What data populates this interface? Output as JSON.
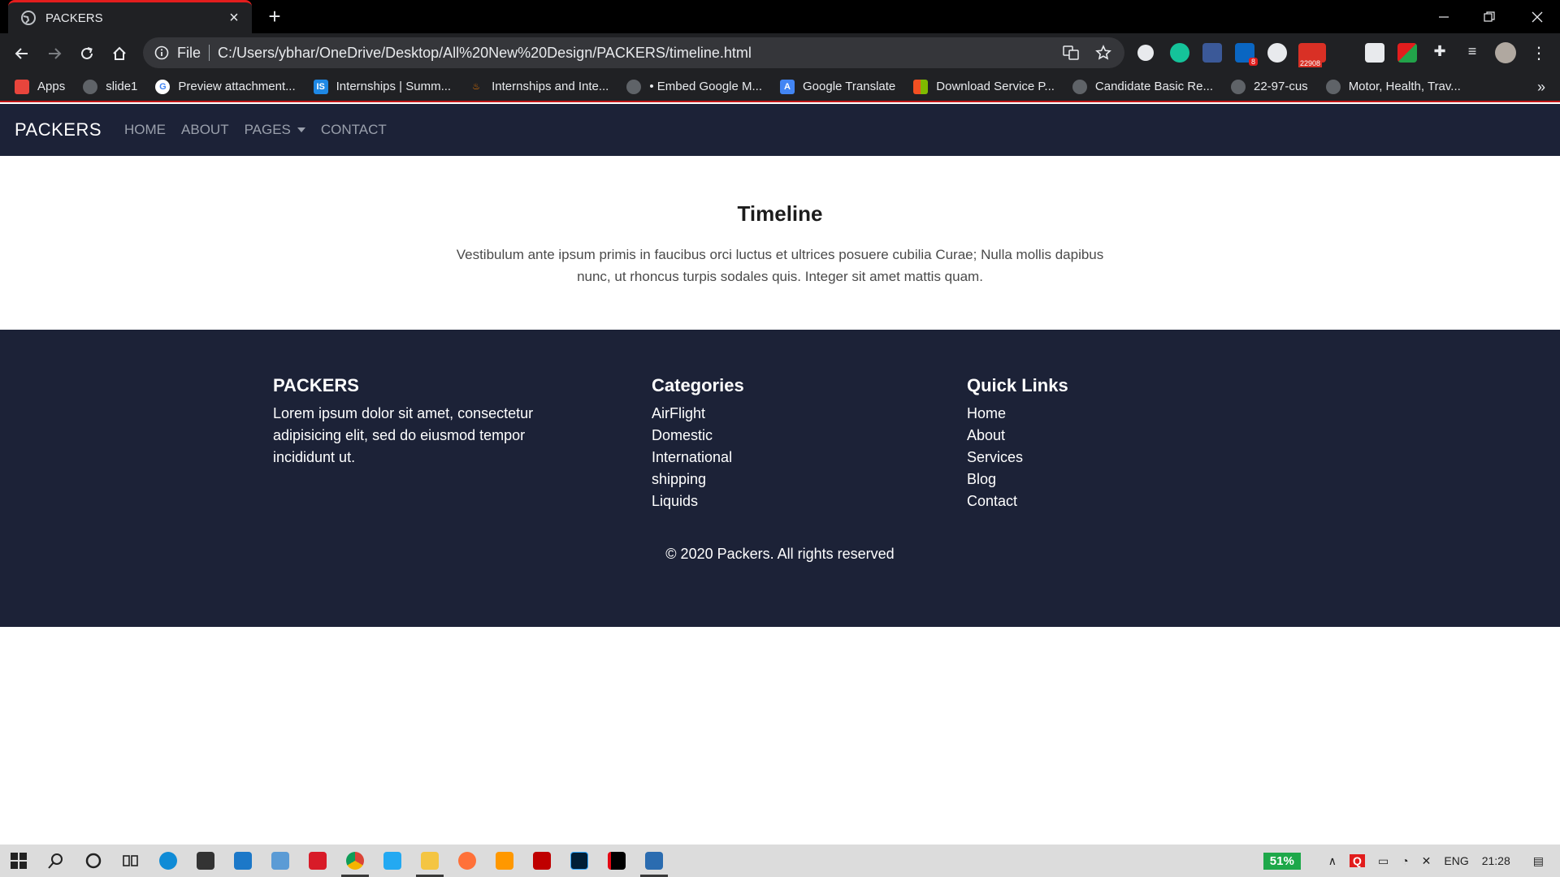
{
  "browser": {
    "tab_title": "PACKERS",
    "new_tab": "+",
    "tab_close": "×",
    "url_scheme": "File",
    "url": "C:/Users/ybhar/OneDrive/Desktop/All%20New%20Design/PACKERS/timeline.html",
    "bookmarks": [
      {
        "label": "Apps",
        "icon": "apps-grid-icon",
        "color": "#e8453c"
      },
      {
        "label": "slide1",
        "icon": "globe-icon",
        "color": "#5f6368"
      },
      {
        "label": "Preview attachment...",
        "icon": "google-icon",
        "color": "#ffffff"
      },
      {
        "label": "Internships | Summ...",
        "icon": "is-icon",
        "color": "#1e88e5"
      },
      {
        "label": "Internships and Inte...",
        "icon": "flame-icon",
        "color": "#202124"
      },
      {
        "label": "• Embed Google M...",
        "icon": "globe-icon",
        "color": "#5f6368"
      },
      {
        "label": "Google Translate",
        "icon": "translate-icon",
        "color": "#4285f4"
      },
      {
        "label": "Download Service P...",
        "icon": "microsoft-icon",
        "color": "#f25022"
      },
      {
        "label": "Candidate Basic Re...",
        "icon": "globe-icon",
        "color": "#5f6368"
      },
      {
        "label": "22-97-cus",
        "icon": "globe-icon",
        "color": "#5f6368"
      },
      {
        "label": "Motor, Health, Trav...",
        "icon": "globe-icon",
        "color": "#5f6368"
      }
    ],
    "more": "»",
    "badges": {
      "linkedin": "8",
      "mail": "22908"
    }
  },
  "site": {
    "brand": "PACKERS",
    "nav": [
      "HOME",
      "ABOUT",
      "PAGES",
      "CONTACT"
    ],
    "hero_title": "Timeline",
    "hero_text": "Vestibulum ante ipsum primis in faucibus orci luctus et ultrices posuere cubilia Curae; Nulla mollis dapibus nunc, ut rhoncus turpis sodales quis. Integer sit amet mattis quam.",
    "footer": {
      "about_title": "PACKERS",
      "about_text": "Lorem ipsum dolor sit amet, consectetur adipisicing elit, sed do eiusmod tempor incididunt ut.",
      "categories_title": "Categories",
      "categories": [
        "AirFlight",
        "Domestic",
        "International",
        "shipping",
        "Liquids"
      ],
      "links_title": "Quick Links",
      "links": [
        "Home",
        "About",
        "Services",
        "Blog",
        "Contact"
      ],
      "copyright": "© 2020 Packers. All rights reserved"
    }
  },
  "taskbar": {
    "battery": "51%",
    "language": "ENG",
    "time": "21:28"
  },
  "colors": {
    "nav_bg": "#1c2237",
    "footer_bg": "#1c2237",
    "chrome_bg": "#202124",
    "tab_accent": "#e21d1d"
  }
}
